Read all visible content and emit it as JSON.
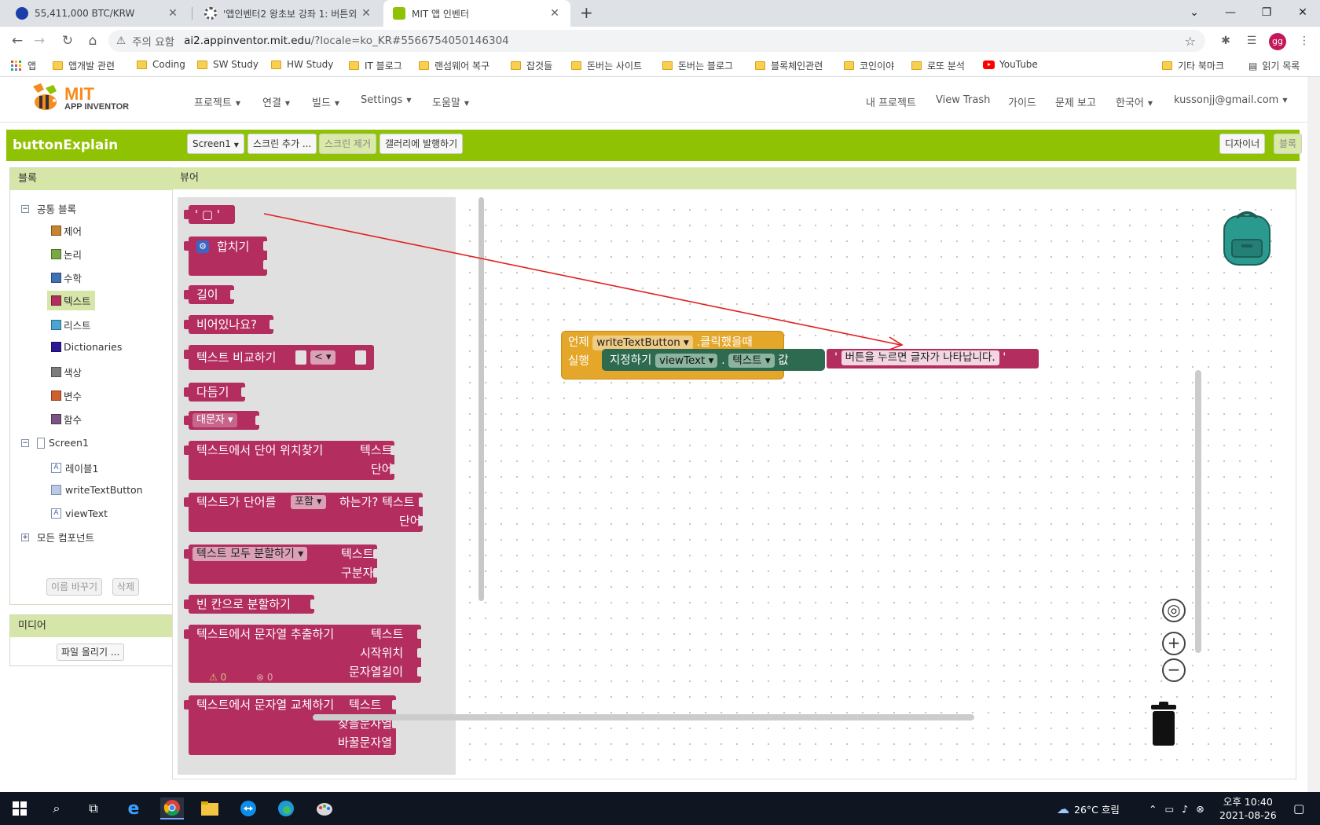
{
  "browser": {
    "tabs": [
      {
        "title": "55,411,000 BTC/KRW",
        "favicon_color": "#1a3fa8"
      },
      {
        "title": "'앱인벤터2 왕초보 강좌 1: 버튼외",
        "favicon_color": "#555555"
      },
      {
        "title": "MIT 앱 인벤터",
        "favicon_color": "#8fc202"
      }
    ],
    "close_glyph": "✕",
    "new_tab_glyph": "+",
    "window_controls": [
      "⌄",
      "—",
      "❐",
      "✕"
    ],
    "security_label": "주의 요함",
    "url_host": "ai2.appinventor.mit.edu",
    "url_path": "/?locale=ko_KR#5566754050146304",
    "profile_initials": "gg",
    "bookmarks": [
      "앱",
      "앱개발 관련",
      "Coding",
      "SW Study",
      "HW Study",
      "IT 블로그",
      "랜섬웨어 복구",
      "잡것들",
      "돈버는 사이트",
      "돈버는 블로그",
      "블록체인관련",
      "코인이야",
      "로또 분석",
      "YouTube",
      "기타 북마크",
      "읽기 목록"
    ]
  },
  "app": {
    "logo_text": "MIT",
    "logo_sub": "APP INVENTOR",
    "menu_left": [
      "프로젝트",
      "연결",
      "빌드",
      "Settings",
      "도움말"
    ],
    "menu_right": [
      "내 프로젝트",
      "View Trash",
      "가이드",
      "문제 보고",
      "한국어",
      "kussonjj@gmail.com"
    ],
    "project_name": "buttonExplain",
    "toolbar": {
      "screen_select": "Screen1",
      "add_screen": "스크린 추가 ...",
      "remove_screen": "스크린 제거",
      "publish_gallery": "갤러리에 발행하기",
      "designer": "디자이너",
      "blocks": "블록"
    }
  },
  "blocks_panel": {
    "title": "블록",
    "builtin_label": "공통 블록",
    "builtin": [
      {
        "label": "제어",
        "color": "#c88330"
      },
      {
        "label": "논리",
        "color": "#77ab41"
      },
      {
        "label": "수학",
        "color": "#3f71b5"
      },
      {
        "label": "텍스트",
        "color": "#b32d5e"
      },
      {
        "label": "리스트",
        "color": "#49a6d4"
      },
      {
        "label": "Dictionaries",
        "color": "#2d1799"
      },
      {
        "label": "색상",
        "color": "#7d7d7d"
      },
      {
        "label": "변수",
        "color": "#d05f2d"
      },
      {
        "label": "함수",
        "color": "#7c5385"
      }
    ],
    "screen_label": "Screen1",
    "components": [
      "레이블1",
      "writeTextButton",
      "viewText"
    ],
    "all_components": "모든 컴포넌트",
    "rename_button": "이름 바꾸기",
    "delete_button": "삭제"
  },
  "media_panel": {
    "title": "미디어",
    "upload_button": "파일 올리기 ..."
  },
  "viewer": {
    "title": "뷰어",
    "flyout": {
      "empty_string": "' ▢ '",
      "join": "합치기",
      "length": "길이",
      "is_empty": "비어있나요?",
      "compare": "텍스트  비교하기",
      "compare_op": "<",
      "trim": "다듬기",
      "upcase": "대문자",
      "starts_at_1": "텍스트에서  단어  위치찾기",
      "starts_at_2": "텍스트",
      "starts_at_3": "단어",
      "contains_1": "텍스트가  단어를",
      "contains_op": "포함",
      "contains_2": "하는가?  텍스트",
      "contains_3": "단어",
      "split_op": "텍스트  모두  분할하기",
      "split_1": "텍스트",
      "split_2": "구분자",
      "split_spaces": "빈  칸으로  분할하기",
      "segment_1": "텍스트에서  문자열  추출하기",
      "segment_2": "텍스트",
      "segment_3": "시작위치",
      "segment_4": "문자열길이",
      "replace_1": "텍스트에서  문자열  교체하기",
      "replace_2": "텍스트",
      "replace_3": "찾을문자열",
      "replace_4": "바꿀문자열"
    },
    "warnings": "0",
    "errors": "0",
    "event_block": {
      "when": "언제",
      "component": "writeTextButton",
      "event": ".클릭했을때",
      "do": "실행",
      "set": "지정하기",
      "target": "viewText",
      "dot": ".",
      "property": "텍스트",
      "to": "값",
      "string": "버튼을  누르면  글자가  나타납니다."
    }
  },
  "taskbar": {
    "weather": "26°C  흐림",
    "time": "오후 10:40",
    "date": "2021-08-26"
  }
}
